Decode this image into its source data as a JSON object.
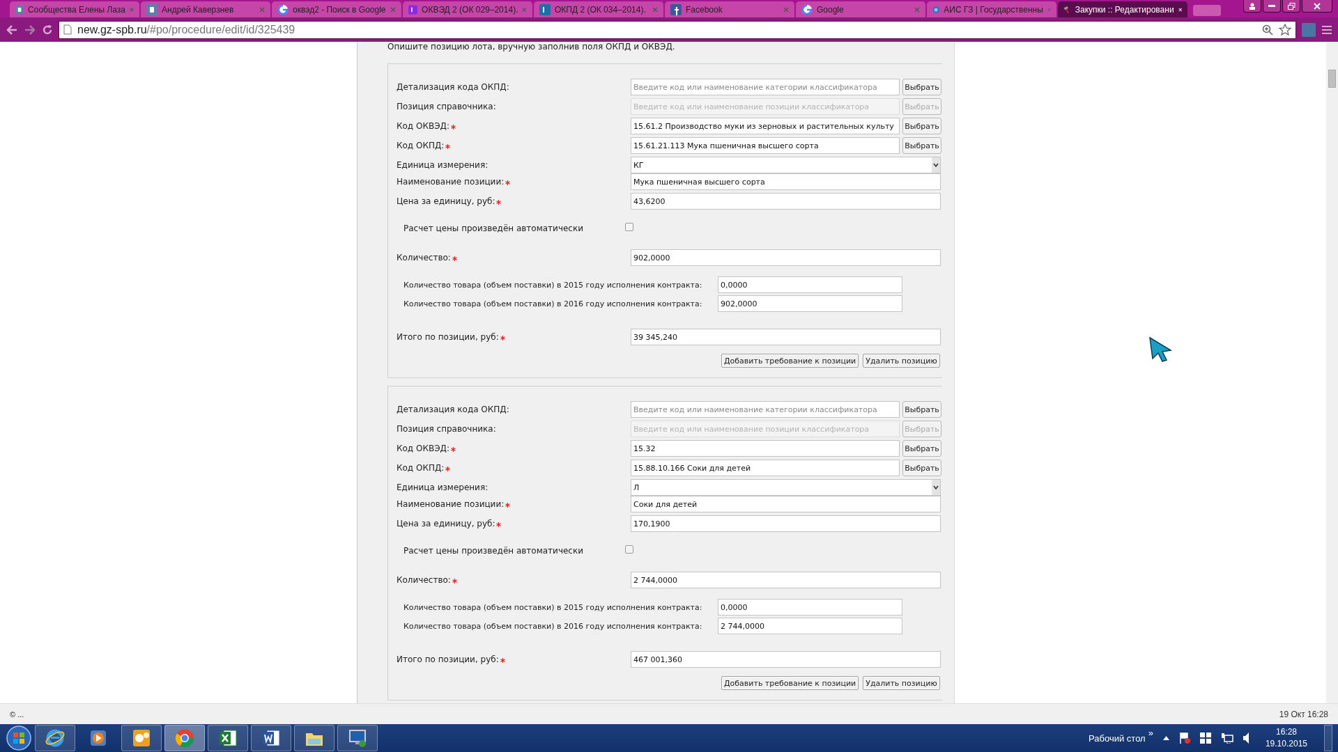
{
  "browser": {
    "tabs": [
      {
        "title": "Сообщества Елены Лаза",
        "kind": "vk",
        "selected": false
      },
      {
        "title": "Андрей Каверзнев",
        "kind": "vk",
        "selected": false
      },
      {
        "title": "оквэд2 - Поиск в Google",
        "kind": "google",
        "selected": false
      },
      {
        "title": "ОКВЭД 2 (ОК 029–2014).",
        "kind": "k-purple",
        "selected": false
      },
      {
        "title": "ОКПД 2 (ОК 034–2014).",
        "kind": "k-blue",
        "selected": false
      },
      {
        "title": "Facebook",
        "kind": "facebook",
        "selected": false
      },
      {
        "title": "Google",
        "kind": "google",
        "selected": false
      },
      {
        "title": "АИС ГЗ | Государственны",
        "kind": "globe",
        "selected": false
      },
      {
        "title": "Закупки :: Редактировани",
        "kind": "hammer",
        "selected": true
      }
    ],
    "address": {
      "domain": "new.gz-spb.ru",
      "path": "/#po/procedure/edit/id/325439"
    }
  },
  "page": {
    "intro": "Опишите позицию лота, вручную заполнив поля ОКПД и ОКВЭД.",
    "positions": [
      {
        "fields": [
          {
            "kind": "lookup",
            "label": "Детализация кода ОКПД:",
            "required": false,
            "placeholder": "Введите код или наименование категории классификатора",
            "button": "Выбрать",
            "disabled": false
          },
          {
            "kind": "lookup",
            "label": "Позиция справочника:",
            "required": false,
            "placeholder": "Введите код или наименование позиции классификатора",
            "button": "Выбрать",
            "disabled": true
          },
          {
            "kind": "lookup",
            "label": "Код ОКВЭД:",
            "required": true,
            "value": "15.61.2 Производство муки из зерновых и растительных культу",
            "button": "Выбрать",
            "disabled": false
          },
          {
            "kind": "lookup",
            "label": "Код ОКПД:",
            "required": true,
            "value": "15.61.21.113 Мука пшеничная высшего сорта",
            "button": "Выбрать",
            "disabled": false
          },
          {
            "kind": "select",
            "label": "Единица измерения:",
            "required": false,
            "value": "КГ"
          },
          {
            "kind": "text",
            "label": "Наименование позиции:",
            "required": true,
            "value": "Мука пшеничная высшего сорта"
          },
          {
            "kind": "text",
            "label": "Цена за единицу, руб:",
            "required": true,
            "value": "43,6200"
          }
        ],
        "auto_price": {
          "label": "Расчет цены произведён автоматически",
          "checked": false
        },
        "quantity": {
          "label": "Количество:",
          "required": true,
          "value": "902,0000"
        },
        "yearly": [
          {
            "label": "Количество товара (объем поставки) в 2015 году исполнения контракта:",
            "value": "0,0000"
          },
          {
            "label": "Количество товара (объем поставки) в 2016 году исполнения контракта:",
            "value": "902,0000"
          }
        ],
        "total": {
          "label": "Итого по позиции, руб:",
          "required": true,
          "value": "39 345,240"
        },
        "actions": [
          "Добавить требование к позиции",
          "Удалить позицию"
        ]
      },
      {
        "fields": [
          {
            "kind": "lookup",
            "label": "Детализация кода ОКПД:",
            "required": false,
            "placeholder": "Введите код или наименование категории классификатора",
            "button": "Выбрать",
            "disabled": false
          },
          {
            "kind": "lookup",
            "label": "Позиция справочника:",
            "required": false,
            "placeholder": "Введите код или наименование позиции классификатора",
            "button": "Выбрать",
            "disabled": true
          },
          {
            "kind": "lookup",
            "label": "Код ОКВЭД:",
            "required": true,
            "value": "15.32",
            "button": "Выбрать",
            "disabled": false
          },
          {
            "kind": "lookup",
            "label": "Код ОКПД:",
            "required": true,
            "value": "15.88.10.166 Соки для детей",
            "button": "Выбрать",
            "disabled": false
          },
          {
            "kind": "select",
            "label": "Единица измерения:",
            "required": false,
            "value": "Л"
          },
          {
            "kind": "text",
            "label": "Наименование позиции:",
            "required": true,
            "value": "Соки для детей"
          },
          {
            "kind": "text",
            "label": "Цена за единицу, руб:",
            "required": true,
            "value": "170,1900"
          }
        ],
        "auto_price": {
          "label": "Расчет цены произведён автоматически",
          "checked": false
        },
        "quantity": {
          "label": "Количество:",
          "required": true,
          "value": "2 744,0000"
        },
        "yearly": [
          {
            "label": "Количество товара (объем поставки) в 2015 году исполнения контракта:",
            "value": "0,0000"
          },
          {
            "label": "Количество товара (объем поставки) в 2016 году исполнения контракта:",
            "value": "2 744,0000"
          }
        ],
        "total": {
          "label": "Итого по позиции, руб:",
          "required": true,
          "value": "467 001,360"
        },
        "actions": [
          "Добавить требование к позиции",
          "Удалить позицию"
        ]
      }
    ]
  },
  "status_bar": {
    "left": "© ...",
    "right": "19 Окт 16:28"
  },
  "taskbar": {
    "apps": [
      {
        "kind": "ie",
        "running": true,
        "selected": false
      },
      {
        "kind": "media",
        "running": false,
        "selected": false
      },
      {
        "kind": "outlook",
        "running": true,
        "selected": false
      },
      {
        "kind": "chrome",
        "running": true,
        "selected": true
      },
      {
        "kind": "excel",
        "running": true,
        "selected": false
      },
      {
        "kind": "word",
        "running": true,
        "selected": false
      },
      {
        "kind": "explorer",
        "running": true,
        "selected": false
      },
      {
        "kind": "remote",
        "running": true,
        "selected": false
      }
    ],
    "desktop_label": "Рабочий стол",
    "overflow": "»",
    "time": "16:28",
    "date": "19.10.2015"
  }
}
